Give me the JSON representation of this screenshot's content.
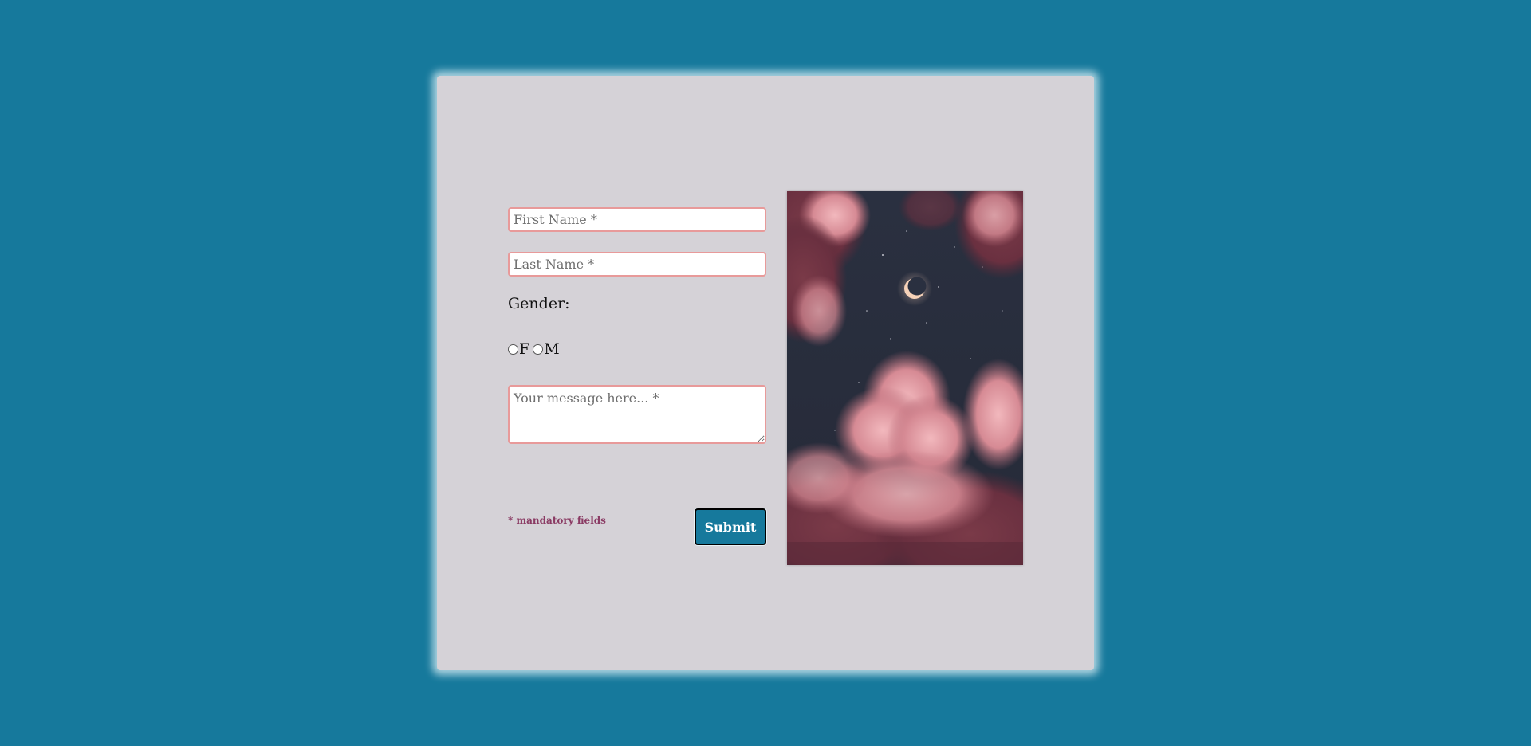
{
  "form": {
    "first_name_placeholder": "First Name *",
    "last_name_placeholder": "Last Name *",
    "gender_label": "Gender:",
    "gender_options": [
      "F",
      "M"
    ],
    "message_placeholder": "Your message here... *",
    "mandatory_note": "* mandatory fields",
    "submit_label": "Submit"
  },
  "colors": {
    "background": "#16799c",
    "card": "#d5d2d7",
    "field_border": "#e89a9a",
    "note": "#8a3a63"
  },
  "image": {
    "subject": "night-sky-pink-clouds-crescent-moon"
  }
}
